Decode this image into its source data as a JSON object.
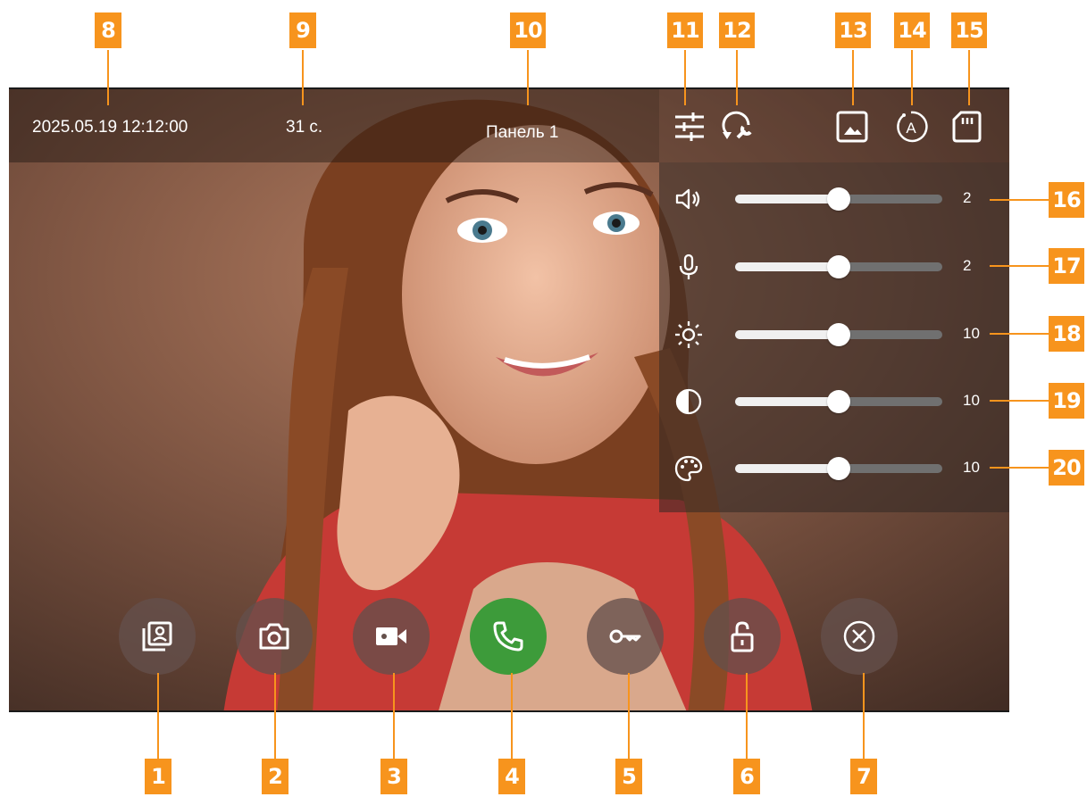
{
  "header": {
    "datetime": "2025.05.19 12:12:00",
    "timer": "31 с.",
    "panel_name": "Панель 1"
  },
  "sliders": [
    {
      "name": "speaker-volume",
      "icon": "speaker-icon",
      "value": "2",
      "level": 0.5
    },
    {
      "name": "microphone-volume",
      "icon": "microphone-icon",
      "value": "2",
      "level": 0.5
    },
    {
      "name": "brightness",
      "icon": "brightness-icon",
      "value": "10",
      "level": 0.5
    },
    {
      "name": "contrast",
      "icon": "contrast-icon",
      "value": "10",
      "level": 0.5
    },
    {
      "name": "color",
      "icon": "palette-icon",
      "value": "10",
      "level": 0.5
    }
  ],
  "callouts": {
    "n1": "1",
    "n2": "2",
    "n3": "3",
    "n4": "4",
    "n5": "5",
    "n6": "6",
    "n7": "7",
    "n8": "8",
    "n9": "9",
    "n10": "10",
    "n11": "11",
    "n12": "12",
    "n13": "13",
    "n14": "14",
    "n15": "15",
    "n16": "16",
    "n17": "17",
    "n18": "18",
    "n19": "19",
    "n20": "20"
  },
  "colors": {
    "accent_callout": "#f7941d",
    "answer_button": "#3d9b3a",
    "button_bg": "#64504b"
  }
}
